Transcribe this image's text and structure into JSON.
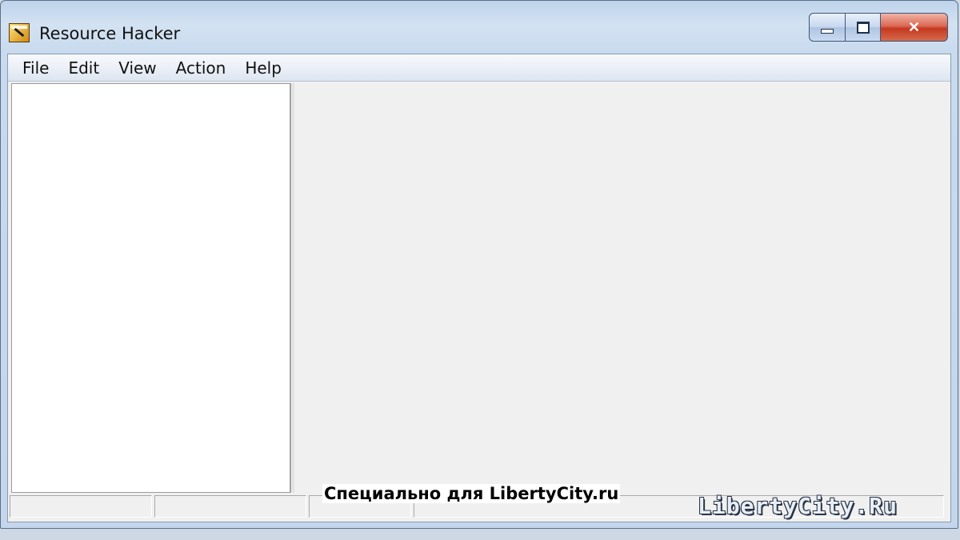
{
  "window": {
    "title": "Resource Hacker",
    "controls": {
      "minimize": "minimize",
      "maximize": "maximize",
      "close": "✕"
    }
  },
  "menu": {
    "items": [
      "File",
      "Edit",
      "View",
      "Action",
      "Help"
    ]
  },
  "statusbar": {
    "panels": [
      "",
      "",
      "",
      ""
    ]
  },
  "watermark": {
    "caption": "Специально для LibertyCity.ru",
    "logo": "LibertyCity.Ru"
  },
  "colors": {
    "titlebar": "#c8daee",
    "close_button": "#c4391f",
    "client_background": "#f0f0f0",
    "tree_background": "#ffffff"
  }
}
